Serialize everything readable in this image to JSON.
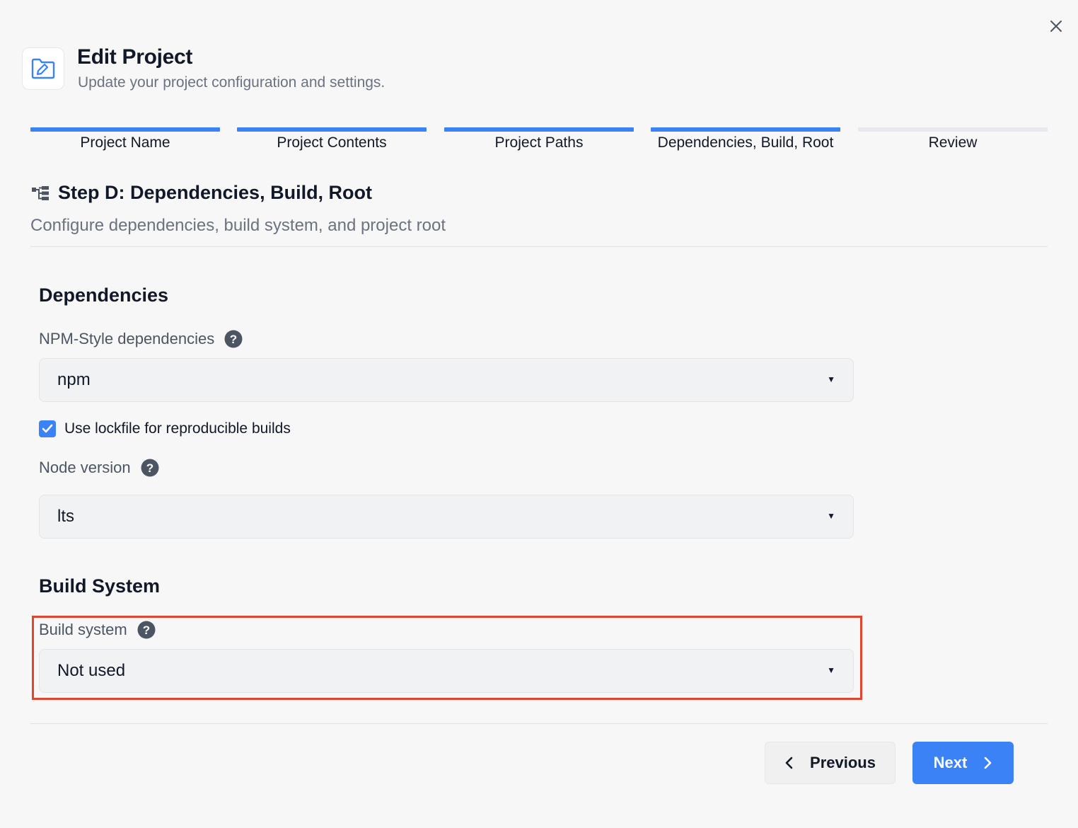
{
  "dialog": {
    "title": "Edit Project",
    "subtitle": "Update your project configuration and settings.",
    "icon": "folder-edit-icon"
  },
  "steps": [
    {
      "label": "Project Name",
      "complete": true
    },
    {
      "label": "Project Contents",
      "complete": true
    },
    {
      "label": "Project Paths",
      "complete": true
    },
    {
      "label": "Dependencies, Build, Root",
      "complete": true
    },
    {
      "label": "Review",
      "complete": false
    }
  ],
  "current_step": {
    "icon": "hierarchy-icon",
    "title": "Step D: Dependencies, Build, Root",
    "description": "Configure dependencies, build system, and project root"
  },
  "dependencies": {
    "section_title": "Dependencies",
    "npm_label": "NPM-Style dependencies",
    "npm_value": "npm",
    "lockfile_label": "Use lockfile for reproducible builds",
    "lockfile_checked": true,
    "node_label": "Node version",
    "node_value": "lts"
  },
  "build": {
    "section_title": "Build System",
    "label": "Build system",
    "value": "Not used"
  },
  "footer": {
    "previous_label": "Previous",
    "next_label": "Next"
  },
  "colors": {
    "accent": "#3b82f6",
    "highlight": "#e0452f"
  }
}
